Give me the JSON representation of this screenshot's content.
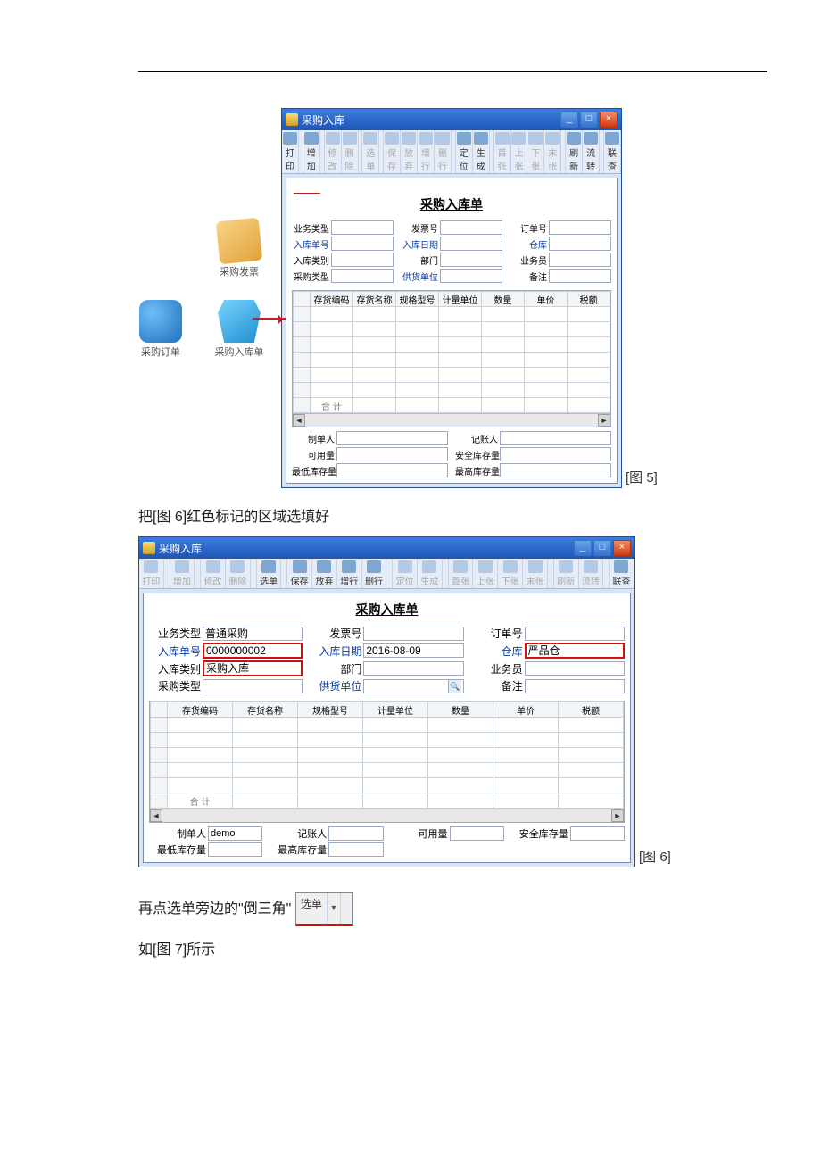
{
  "doc": {
    "instruction_fig6": "把[图 6]红色标记的区域选填好",
    "instruction_triangle_prefix": "再点选单旁边的\"倒三角\"",
    "instruction_fig7": "如[图 7]所示",
    "caption_fig5": "[图 5]",
    "caption_fig6": "[图 6]"
  },
  "icons": {
    "invoice": "采购发票",
    "order": "采购订单",
    "in": "采购入库单"
  },
  "window": {
    "title": "采购入库",
    "form_title": "采购入库单"
  },
  "toolbar_small": [
    "打印",
    "增加",
    "修改",
    "删除",
    "选单",
    "保存",
    "放弃",
    "增行",
    "删行",
    "定位",
    "生成",
    "首张",
    "上张",
    "下张",
    "末张",
    "刷新",
    "流转",
    "联查"
  ],
  "toolbar_small_disabled": [
    2,
    3,
    4,
    5,
    6,
    7,
    8,
    11,
    12,
    13,
    14
  ],
  "toolbar_large": [
    "打印",
    "增加",
    "修改",
    "删除",
    "选单",
    "保存",
    "放弃",
    "增行",
    "删行",
    "定位",
    "生成",
    "首张",
    "上张",
    "下张",
    "末张",
    "刷新",
    "流转",
    "联查"
  ],
  "toolbar_large_disabled": [
    0,
    1,
    2,
    3,
    9,
    10,
    11,
    12,
    13,
    14,
    15,
    16
  ],
  "form_fields": [
    {
      "label": "业务类型",
      "blue": false
    },
    {
      "label": "发票号",
      "blue": false
    },
    {
      "label": "订单号",
      "blue": false
    },
    {
      "label": "入库单号",
      "blue": true
    },
    {
      "label": "入库日期",
      "blue": true
    },
    {
      "label": "仓库",
      "blue": true
    },
    {
      "label": "入库类别",
      "blue": false
    },
    {
      "label": "部门",
      "blue": false
    },
    {
      "label": "业务员",
      "blue": false
    },
    {
      "label": "采购类型",
      "blue": false
    },
    {
      "label": "供货单位",
      "blue": true
    },
    {
      "label": "备注",
      "blue": false
    }
  ],
  "form_values_small": [
    "",
    "",
    "",
    "",
    "",
    "",
    "",
    "",
    "",
    "",
    "",
    ""
  ],
  "form_values_large": [
    "普通采购",
    "",
    "",
    "0000000002",
    "2016-08-09",
    "严品仓",
    "采购入库",
    "",
    "",
    "",
    "",
    ""
  ],
  "red_boxed_large": [
    6,
    3,
    5
  ],
  "table_headers": [
    "存货编码",
    "存货名称",
    "规格型号",
    "计量单位",
    "数量",
    "单价",
    "税额"
  ],
  "table_sum_label": "合   计",
  "footer_small": [
    {
      "label": "制单人",
      "value": ""
    },
    {
      "label": "记账人",
      "value": ""
    },
    {
      "label": "可用量",
      "value": ""
    },
    {
      "label": "安全库存量",
      "value": ""
    },
    {
      "label": "最低库存量",
      "value": ""
    },
    {
      "label": "最高库存量",
      "value": ""
    }
  ],
  "footer_large": [
    {
      "label": "制单人",
      "value": "demo"
    },
    {
      "label": "记账人",
      "value": ""
    },
    {
      "label": "可用量",
      "value": ""
    },
    {
      "label": "安全库存量",
      "value": ""
    },
    {
      "label": "最低库存量",
      "value": ""
    },
    {
      "label": "最高库存量",
      "value": ""
    }
  ],
  "snippet_label": "选单"
}
